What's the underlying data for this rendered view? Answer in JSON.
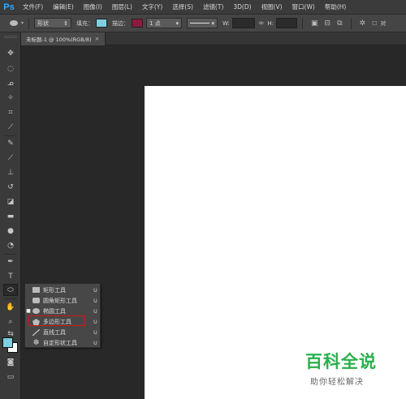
{
  "app": {
    "logo": "Ps"
  },
  "menu": [
    "文件(F)",
    "编辑(E)",
    "图像(I)",
    "图层(L)",
    "文字(Y)",
    "选择(S)",
    "滤镜(T)",
    "3D(D)",
    "视图(V)",
    "窗口(W)",
    "帮助(H)"
  ],
  "options": {
    "mode": "形状",
    "fill_label": "填充：",
    "fill_color": "#7ecfe0",
    "stroke_label": "描边：",
    "stroke_color": "#8b1a3c",
    "stroke_width": "1 点",
    "w_label": "W:",
    "h_label": "H:",
    "align_label": "对"
  },
  "document": {
    "tab_title": "未标题-1 @ 100%(RGB/8)",
    "close": "×"
  },
  "flyout": {
    "items": [
      {
        "label": "矩形工具",
        "key": "U",
        "selected": false
      },
      {
        "label": "圆角矩形工具",
        "key": "U",
        "selected": false
      },
      {
        "label": "椭圆工具",
        "key": "U",
        "selected": true
      },
      {
        "label": "多边形工具",
        "key": "U",
        "selected": false
      },
      {
        "label": "直线工具",
        "key": "U",
        "selected": false
      },
      {
        "label": "自定形状工具",
        "key": "U",
        "selected": false
      }
    ],
    "selected_marker": "■"
  },
  "colors": {
    "foreground": "#7ecfe0",
    "background": "#ffffff",
    "highlight": "#d01818"
  },
  "watermark": {
    "title": "百科全说",
    "subtitle": "助你轻松解决"
  }
}
